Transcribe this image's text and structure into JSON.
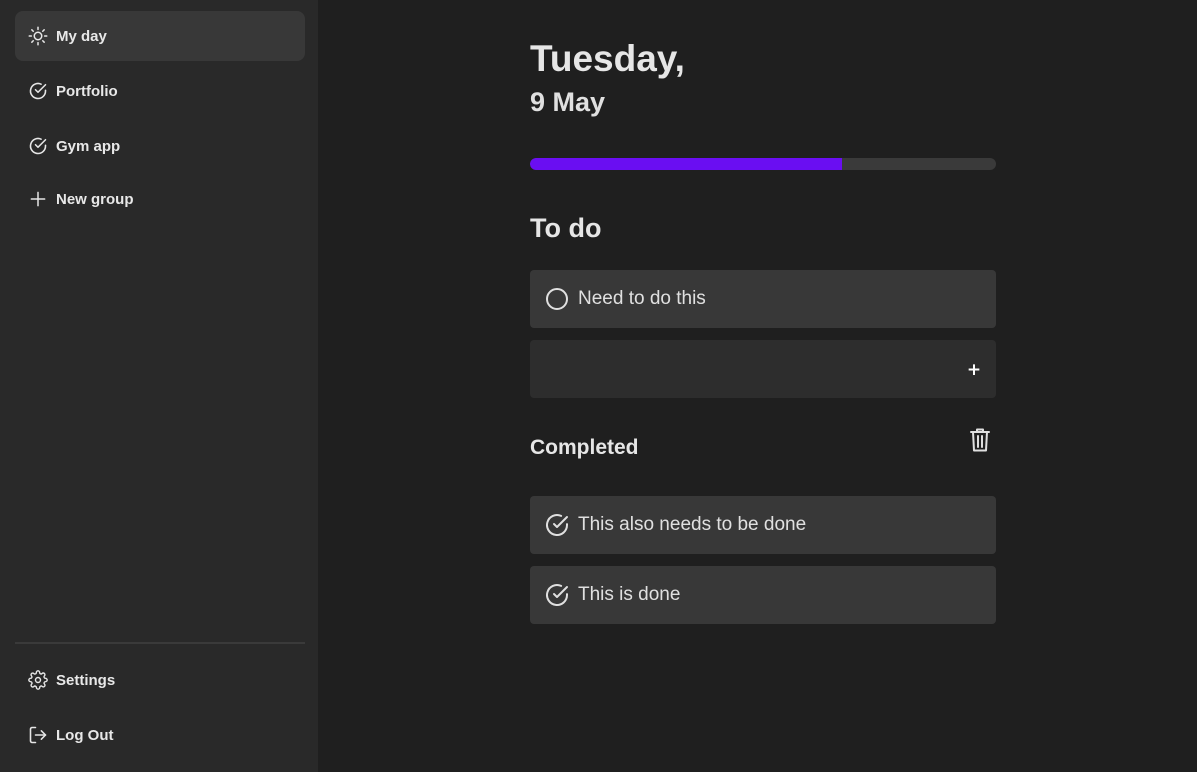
{
  "sidebar": {
    "items": [
      {
        "label": "My day",
        "icon": "sun-icon"
      },
      {
        "label": "Portfolio",
        "icon": "check-circle-icon"
      },
      {
        "label": "Gym app",
        "icon": "check-circle-icon"
      },
      {
        "label": "New group",
        "icon": "plus-icon"
      }
    ],
    "bottom": [
      {
        "label": "Settings",
        "icon": "gear-icon"
      },
      {
        "label": "Log Out",
        "icon": "logout-icon"
      }
    ]
  },
  "main": {
    "day": "Tuesday,",
    "date": "9 May",
    "progress_percent": 67,
    "todo_title": "To do",
    "todo_tasks": [
      {
        "label": "Need to do this",
        "icon": "circle-icon"
      }
    ],
    "add_input_placeholder": "",
    "add_button_label": "+",
    "completed_title": "Completed",
    "completed_tasks": [
      {
        "label": "This also needs to be done",
        "icon": "check-circle-icon"
      },
      {
        "label": "This is done",
        "icon": "check-circle-icon"
      }
    ]
  },
  "colors": {
    "accent": "#6a0ef2",
    "sidebar_bg": "#292929",
    "main_bg": "#1f1f1f",
    "task_bg": "#383838"
  }
}
